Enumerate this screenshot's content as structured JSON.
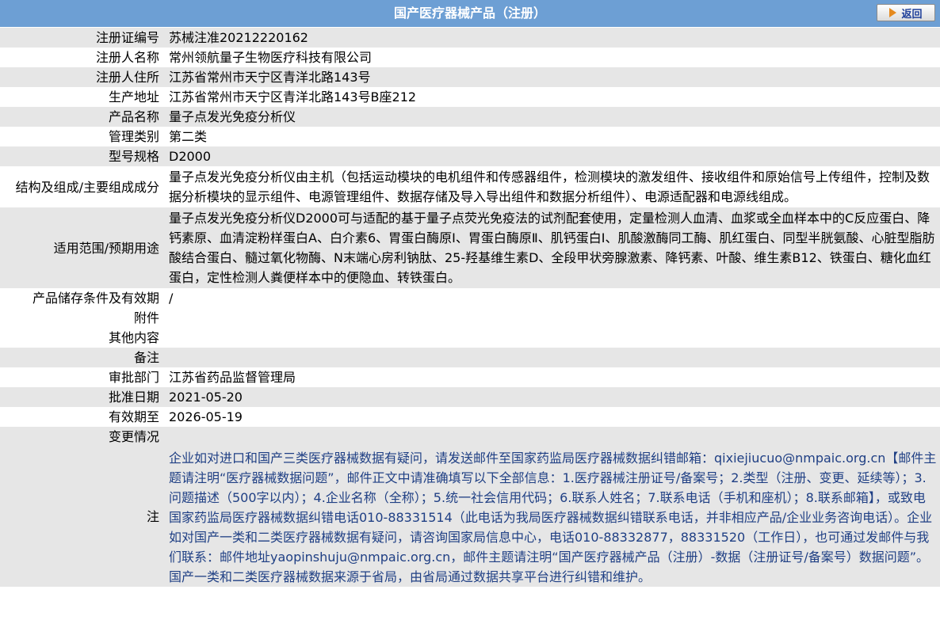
{
  "header": {
    "title": "国产医疗器械产品（注册）",
    "back_label": "返回"
  },
  "rows": [
    {
      "label": "注册证编号",
      "value": "苏械注准20212220162"
    },
    {
      "label": "注册人名称",
      "value": "常州领航量子生物医疗科技有限公司"
    },
    {
      "label": "注册人住所",
      "value": "江苏省常州市天宁区青洋北路143号"
    },
    {
      "label": "生产地址",
      "value": "江苏省常州市天宁区青洋北路143号B座212"
    },
    {
      "label": "产品名称",
      "value": "量子点发光免疫分析仪"
    },
    {
      "label": "管理类别",
      "value": "第二类"
    },
    {
      "label": "型号规格",
      "value": "D2000"
    },
    {
      "label": "结构及组成/主要组成成分",
      "value": "量子点发光免疫分析仪由主机（包括运动模块的电机组件和传感器组件，检测模块的激发组件、接收组件和原始信号上传组件，控制及数据分析模块的显示组件、电源管理组件、数据存储及导入导出组件和数据分析组件）、电源适配器和电源线组成。"
    },
    {
      "label": "适用范围/预期用途",
      "value": "量子点发光免疫分析仪D2000可与适配的基于量子点荧光免疫法的试剂配套使用，定量检测人血清、血浆或全血样本中的C反应蛋白、降钙素原、血清淀粉样蛋白A、白介素6、胃蛋白酶原Ⅰ、胃蛋白酶原Ⅱ、肌钙蛋白I、肌酸激酶同工酶、肌红蛋白、同型半胱氨酸、心脏型脂肪酸结合蛋白、髓过氧化物酶、N末端心房利钠肽、25-羟基维生素D、全段甲状旁腺激素、降钙素、叶酸、维生素B12、铁蛋白、糖化血红蛋白，定性检测人粪便样本中的便隐血、转铁蛋白。"
    },
    {
      "label": "产品储存条件及有效期",
      "value": "/"
    },
    {
      "label": "附件",
      "value": ""
    },
    {
      "label": "其他内容",
      "value": ""
    },
    {
      "label": "备注",
      "value": ""
    },
    {
      "label": "审批部门",
      "value": "江苏省药品监督管理局"
    },
    {
      "label": "批准日期",
      "value": "2021-05-20"
    },
    {
      "label": "有效期至",
      "value": "2026-05-19"
    },
    {
      "label": "变更情况",
      "value": ""
    }
  ],
  "note": {
    "label": "注",
    "text": "企业如对进口和国产三类医疗器械数据有疑问，请发送邮件至国家药监局医疗器械数据纠错邮箱：qixiejiucuo@nmpaic.org.cn【邮件主题请注明“医疗器械数据问题”，邮件正文中请准确填写以下全部信息：1.医疗器械注册证号/备案号；2.类型（注册、变更、延续等）；3.问题描述（500字以内）；4.企业名称（全称）；5.统一社会信用代码；6.联系人姓名；7.联系电话（手机和座机）；8.联系邮箱】，或致电国家药监局医疗器械数据纠错电话010-88331514（此电话为我局医疗器械数据纠错联系电话，并非相应产品/企业业务咨询电话）。企业如对国产一类和二类医疗器械数据有疑问，请咨询国家局信息中心，电话010-88332877，88331520（工作日），也可通过发邮件与我们联系：邮件地址yaopinshuju@nmpaic.org.cn，邮件主题请注明“国产医疗器械产品（注册）-数据（注册证号/备案号）数据问题”。国产一类和二类医疗器械数据来源于省局，由省局通过数据共享平台进行纠错和维护。"
  },
  "colors": {
    "header_bg": "#6d9fd4",
    "row_alt_bg": "#e6e6e6",
    "note_text": "#1f3f84"
  }
}
